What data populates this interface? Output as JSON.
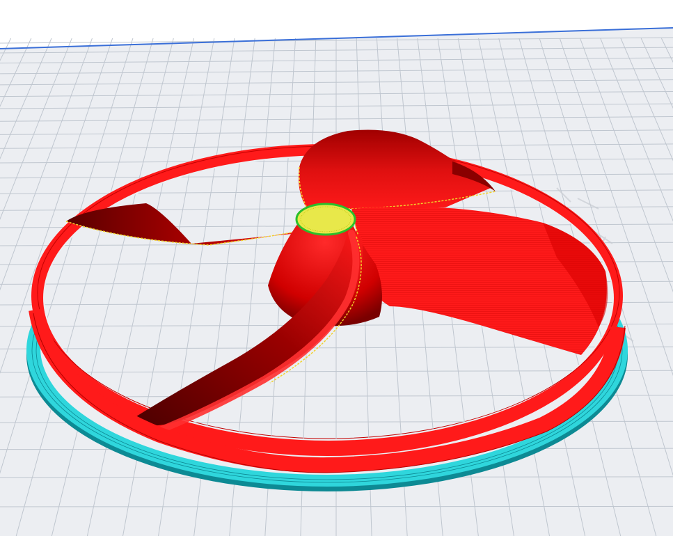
{
  "viewer": {
    "background_color": "#ffffff",
    "build_plate": {
      "color": "#eceef2",
      "grid_major_color": "#bfc6cf",
      "grid_minor_color": "#dde1e7",
      "edge_color": "#3a6fd8"
    },
    "model": {
      "name": "",
      "wall_color": "#ff1a1a",
      "wall_shadow_color": "#8a0000",
      "hub_top_color": "#e8e84a",
      "hub_outline_color": "#2bbf2b",
      "seam_color": "#f2d22a",
      "skirt_color": "#2fd6dc",
      "skirt_shadow_color": "#0d8a94",
      "blade_count": 3
    }
  }
}
